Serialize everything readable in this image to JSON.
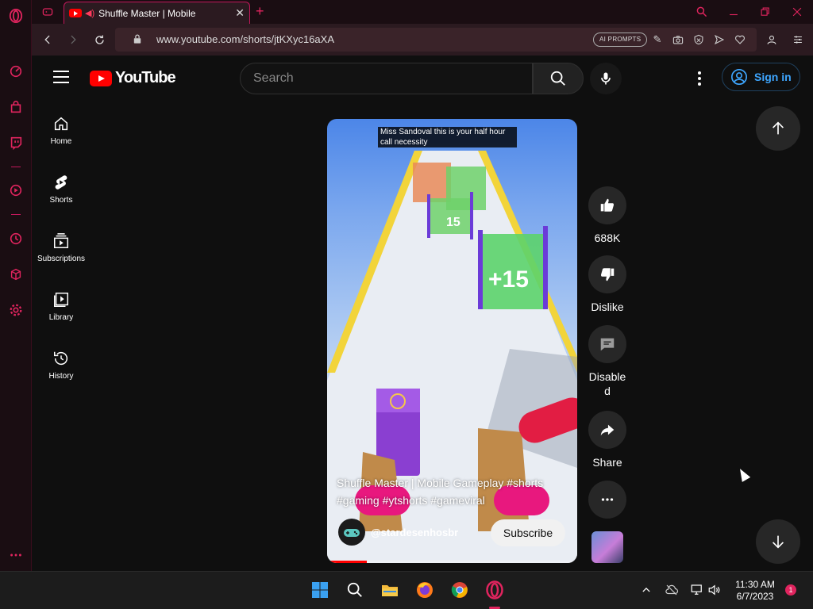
{
  "browser": {
    "tab": {
      "title": "Shuffle Master | Mobile",
      "close": "✕"
    },
    "new_tab": "+",
    "url": "www.youtube.com/shorts/jtKXyc16aXA",
    "ai_prompts": "AI PROMPTS"
  },
  "youtube": {
    "logo_text": "YouTube",
    "search_placeholder": "Search",
    "sign_in": "Sign in",
    "sidebar": [
      {
        "label": "Home",
        "icon": "home-icon"
      },
      {
        "label": "Shorts",
        "icon": "shorts-icon"
      },
      {
        "label": "Subscriptions",
        "icon": "subscriptions-icon"
      },
      {
        "label": "Library",
        "icon": "library-icon"
      },
      {
        "label": "History",
        "icon": "history-icon"
      }
    ]
  },
  "short": {
    "caption": "Miss Sandoval this is your half hour call necessity",
    "title": "Shuffle Master | Mobile Gameplay #shorts #gaming #ytshorts #gameviral",
    "channel": "@stardesenhosbr",
    "subscribe": "Subscribe",
    "progress": 0.16,
    "actions": {
      "like": "688K",
      "dislike": "Dislike",
      "comments": "Disabled",
      "share": "Share"
    }
  },
  "taskbar": {
    "time": "11:30 AM",
    "date": "6/7/2023",
    "notifications": "1"
  },
  "colors": {
    "opera_accent": "#e0245e",
    "yt_red": "#ff0000",
    "sign_in_blue": "#3ea6ff"
  }
}
